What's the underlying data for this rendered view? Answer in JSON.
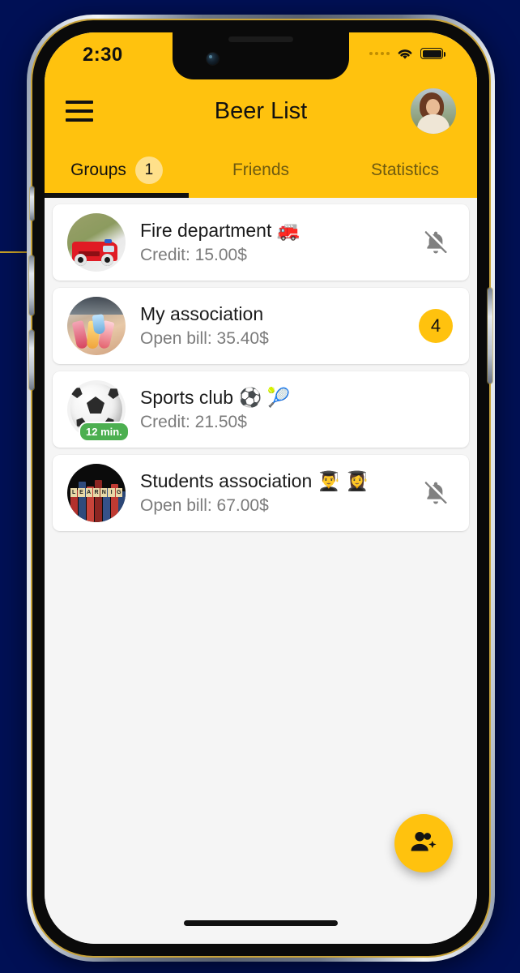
{
  "status_bar": {
    "time": "2:30",
    "signal_icon": "signal-dots-icon",
    "wifi_icon": "wifi-icon",
    "battery_icon": "battery-full-icon"
  },
  "app_bar": {
    "menu_icon": "hamburger-menu-icon",
    "title": "Beer List",
    "avatar_icon": "user-avatar-photo"
  },
  "tabs": [
    {
      "label": "Groups",
      "badge": "1",
      "active": true
    },
    {
      "label": "Friends",
      "badge": "",
      "active": false
    },
    {
      "label": "Statistics",
      "badge": "",
      "active": false
    }
  ],
  "groups": [
    {
      "title": "Fire department 🚒",
      "subtitle": "Credit: 15.00$",
      "avatar_icon": "fire-truck-photo",
      "trailing_type": "bell-off",
      "trailing_icon": "bell-off-icon",
      "badge": "",
      "time_chip": ""
    },
    {
      "title": "My association",
      "subtitle": "Open bill: 35.40$",
      "avatar_icon": "cocktails-photo",
      "trailing_type": "badge",
      "trailing_icon": "",
      "badge": "4",
      "time_chip": ""
    },
    {
      "title": "Sports club ⚽ 🎾",
      "subtitle": "Credit: 21.50$",
      "avatar_icon": "soccer-ball-photo",
      "trailing_type": "none",
      "trailing_icon": "",
      "badge": "",
      "time_chip": "12 min."
    },
    {
      "title": "Students association 👨‍🎓 👩‍🎓",
      "subtitle": "Open bill: 67.00$",
      "avatar_icon": "books-photo",
      "trailing_type": "bell-off",
      "trailing_icon": "bell-off-icon",
      "badge": "",
      "time_chip": ""
    }
  ],
  "fab": {
    "icon": "add-group-icon",
    "label": ""
  },
  "colors": {
    "accent": "#FFC20E",
    "badge_light": "#FFE08A",
    "page_background": "#001055",
    "list_background": "#F5F5F5",
    "card_background": "#FFFFFF",
    "chip_green": "#4CAF50",
    "text_primary": "#1B1B1B",
    "text_secondary": "#7B7B7B"
  }
}
